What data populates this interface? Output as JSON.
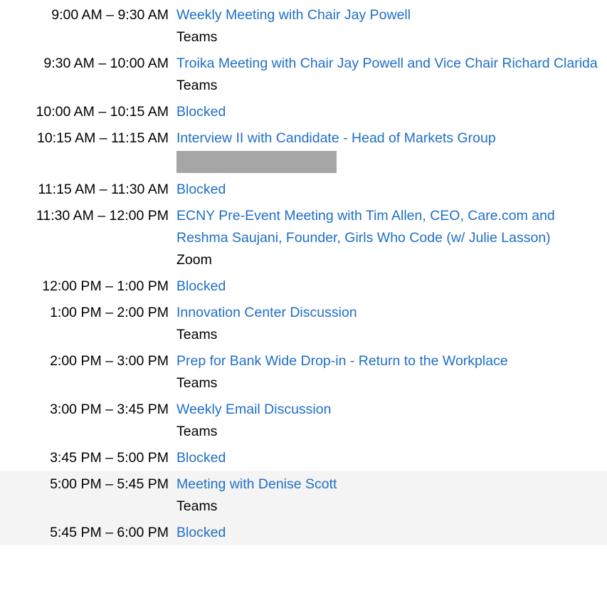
{
  "events": [
    {
      "time": "9:00 AM – 9:30 AM",
      "title": "Weekly Meeting with Chair Jay Powell",
      "location": "Teams"
    },
    {
      "time": "9:30 AM – 10:00 AM",
      "title": "Troika Meeting with Chair Jay Powell and Vice Chair Richard Clarida",
      "location": "Teams"
    },
    {
      "time": "10:00 AM – 10:15 AM",
      "title": "Blocked",
      "location": ""
    },
    {
      "time": "10:15 AM – 11:15 AM",
      "title": "Interview II with Candidate - Head of Markets Group",
      "location": "",
      "redacted": true
    },
    {
      "time": "11:15 AM – 11:30 AM",
      "title": "Blocked",
      "location": ""
    },
    {
      "time": "11:30 AM – 12:00 PM",
      "title": "ECNY Pre-Event Meeting with Tim Allen, CEO, Care.com and Reshma Saujani, Founder, Girls Who Code (w/ Julie Lasson)",
      "location": "Zoom"
    },
    {
      "time": "12:00 PM – 1:00 PM",
      "title": "Blocked",
      "location": ""
    },
    {
      "time": "1:00 PM – 2:00 PM",
      "title": "Innovation Center Discussion",
      "location": "Teams"
    },
    {
      "time": "2:00 PM – 3:00 PM",
      "title": "Prep for Bank Wide Drop-in - Return to the Workplace",
      "location": "Teams"
    },
    {
      "time": "3:00 PM – 3:45 PM",
      "title": "Weekly Email Discussion",
      "location": "Teams"
    },
    {
      "time": "3:45 PM – 5:00 PM",
      "title": "Blocked",
      "location": ""
    },
    {
      "time": "5:00 PM – 5:45 PM",
      "title": "Meeting with Denise Scott",
      "location": "Teams",
      "highlighted": true
    },
    {
      "time": "5:45 PM – 6:00 PM",
      "title": "Blocked",
      "location": "",
      "highlighted": true
    }
  ],
  "colors": {
    "link": "#1f6fc7",
    "text": "#000000",
    "redaction": "#a6a6a6",
    "highlight_row": "#f4f4f4"
  }
}
